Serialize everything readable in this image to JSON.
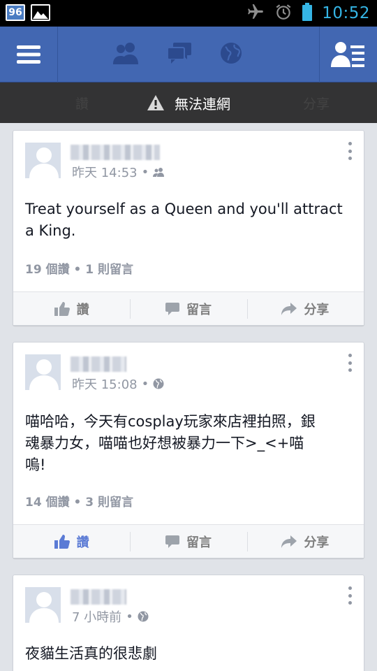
{
  "status_bar": {
    "badge": "96",
    "time": "10:52",
    "icons": [
      "airplane-mode-icon",
      "alarm-clock-icon",
      "battery-icon"
    ]
  },
  "navbar": {
    "icons": [
      "menu-icon",
      "friend-requests-icon",
      "messages-icon",
      "notifications-globe-icon",
      "friends-list-icon"
    ]
  },
  "error_banner": {
    "text": "無法連網",
    "ghost_like": "讚",
    "ghost_share": "分享"
  },
  "posts": [
    {
      "time": "昨天 14:53",
      "audience_icon": "friends-icon",
      "text": "Treat yourself as a Queen and you'll attract a King.",
      "counts": "19 個讚 • 1 則留言",
      "liked": false
    },
    {
      "time": "昨天 15:08",
      "audience_icon": "globe-icon",
      "text": "喵哈哈，今天有cosplay玩家來店裡拍照，銀魂暴力女，喵喵也好想被暴力一下>_<+喵嗚!",
      "counts": "14 個讚 • 3 則留言",
      "liked": true
    },
    {
      "time": "7 小時前",
      "audience_icon": "globe-icon",
      "text": "夜貓生活真的很悲劇",
      "counts": "",
      "liked": false
    }
  ],
  "actions": {
    "like": "讚",
    "comment": "留言",
    "share": "分享"
  },
  "colors": {
    "facebook_blue": "#4267b2",
    "liked_blue": "#5b7bd5",
    "status_time": "#35b5e5"
  }
}
